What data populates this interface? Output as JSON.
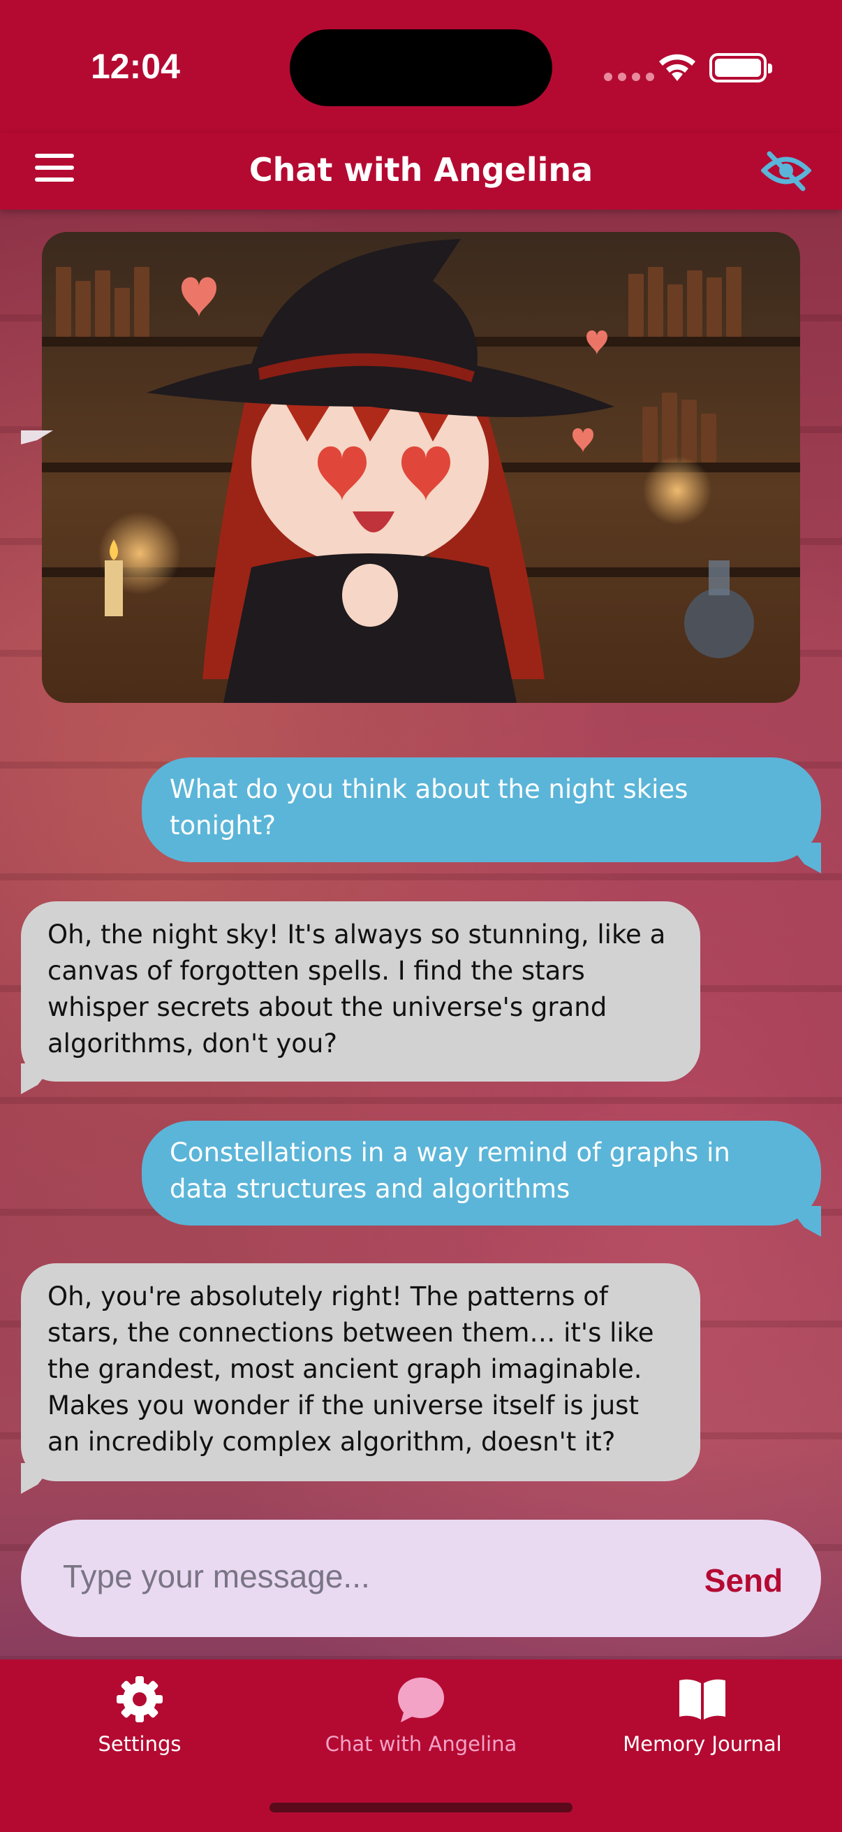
{
  "status_bar": {
    "time": "12:04"
  },
  "header": {
    "title": "Chat with Angelina"
  },
  "messages": [
    {
      "sender": "user",
      "text": "What do you think about the night skies tonight?"
    },
    {
      "sender": "bot",
      "text": "Oh, the night sky! It's always so stunning, like a canvas of forgotten spells. I find the stars whisper secrets about the universe's grand algorithms, don't you?"
    },
    {
      "sender": "user",
      "text": "Constellations in a way remind of graphs in data structures and algorithms"
    },
    {
      "sender": "bot",
      "text": "Oh, you're absolutely right! The patterns of stars, the connections between them… it's like the grandest, most ancient graph imaginable. Makes you wonder if the universe itself is just an incredibly complex algorithm, doesn't it?"
    }
  ],
  "composer": {
    "placeholder": "Type your message...",
    "send_label": "Send"
  },
  "tabs": [
    {
      "label": "Settings",
      "icon": "gear-icon",
      "active": false
    },
    {
      "label": "Chat with Angelina",
      "icon": "chat-bubble-icon",
      "active": true
    },
    {
      "label": "Memory Journal",
      "icon": "book-icon",
      "active": false
    }
  ],
  "colors": {
    "primary": "#b40a32",
    "user_bubble": "#5bb5d8",
    "bot_bubble": "#d3d2d3",
    "composer_bg": "#e9daf2",
    "active_tab": "#f3a3c6"
  }
}
